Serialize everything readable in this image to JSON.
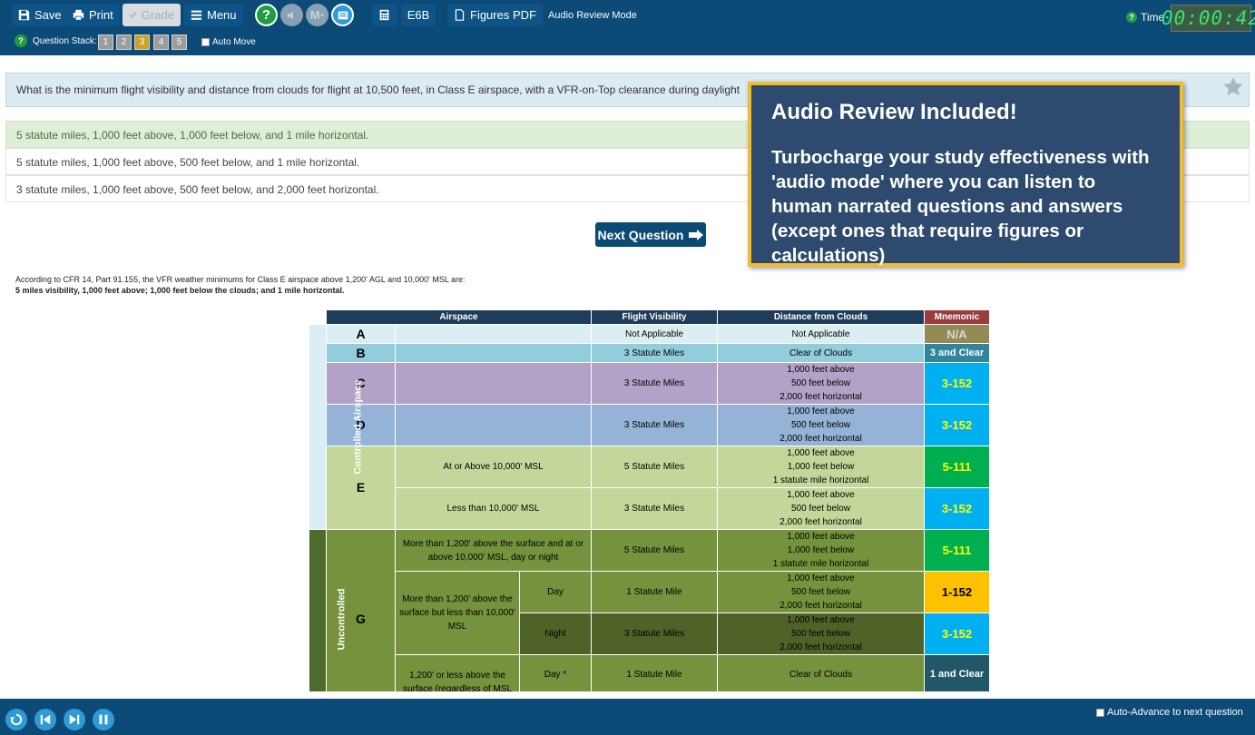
{
  "toolbar": {
    "save_label": "Save",
    "print_label": "Print",
    "grade_label": "Grade",
    "menu_label": "Menu",
    "e6b_label": "E6B",
    "figures_label": "Figures PDF",
    "mode_label": "Audio Review Mode",
    "help_icon": "question-icon",
    "mute_icon": "speaker-mute-icon",
    "memory_label": "M",
    "notes_icon": "notes-icon",
    "calculator_icon": "calculator-icon",
    "question_stack_label": "Question Stack:",
    "question_stack": [
      "1",
      "2",
      "3",
      "4",
      "5"
    ],
    "current_stack_item": "3",
    "auto_move_label": "Auto Move",
    "time_label": "Time",
    "timer": "00:00:42",
    "accent": "#0c4a77"
  },
  "question": {
    "text": "What is the minimum flight visibility and distance from clouds for flight at 10,500 feet, in Class E airspace, with a VFR-on-Top clearance during daylight"
  },
  "answers": [
    {
      "text": "5 statute miles, 1,000 feet above, 1,000 feet below, and 1 mile horizontal.",
      "correct": true
    },
    {
      "text": "5 statute miles, 1,000 feet above, 500 feet below, and 1 mile horizontal.",
      "correct": false
    },
    {
      "text": "3 statute miles, 1,000 feet above, 500 feet below, and 2,000 feet horizontal.",
      "correct": false
    }
  ],
  "next_button_label": "Next Question",
  "callout": {
    "title": "Audio Review Included!",
    "body": "Turbocharge your study effectiveness with 'audio mode' where you can listen to human narrated  questions and answers (except ones that require figures or calculations)"
  },
  "explanation": {
    "line1": "According to CFR 14, Part 91.155, the VFR weather minimums for Class E airspace above 1,200' AGL and 10,000' MSL are:",
    "line2": "5 miles visibility, 1,000 feet above; 1,000 feet below the clouds; and 1 mile horizontal."
  },
  "table": {
    "headers": {
      "airspace": "Airspace",
      "visibility": "Flight Visibility",
      "clouds": "Distance from Clouds",
      "mnemonic": "Mnemonic"
    },
    "side_controlled": "Controlled Airspace",
    "side_uncontrolled": "Uncontrolled",
    "classes": {
      "a": "A",
      "b": "B",
      "c": "C",
      "d": "D",
      "e": "E",
      "g": "G"
    },
    "row_a": {
      "vis": "Not Applicable",
      "clouds": "Not Applicable",
      "mn": "N/A"
    },
    "row_b": {
      "vis": "3 Statute Miles",
      "clouds": "Clear of Clouds",
      "mn": "3 and Clear"
    },
    "row_c": {
      "vis": "3 Statute Miles",
      "c1": "1,000 feet above",
      "c2": "500 feet below",
      "c3": "2,000 feet horizontal",
      "mn": "3-152"
    },
    "row_d": {
      "vis": "3 Statute Miles",
      "c1": "1,000 feet above",
      "c2": "500 feet below",
      "c3": "2,000 feet horizontal",
      "mn": "3-152"
    },
    "row_e1": {
      "desc": "At or Above 10,000' MSL",
      "vis": "5 Statute Miles",
      "c1": "1,000 feet above",
      "c2": "1,000 feet below",
      "c3": "1 statute mile horizontal",
      "mn": "5-111"
    },
    "row_e2": {
      "desc": "Less than 10,000' MSL",
      "vis": "3 Statute Miles",
      "c1": "1,000 feet above",
      "c2": "500 feet below",
      "c3": "2,000 feet horizontal",
      "mn": "3-152"
    },
    "row_g1": {
      "desc": "More than 1,200' above the surface and at or above 10,000' MSL, day or night",
      "vis": "5 Statute Miles",
      "c1": "1,000 feet above",
      "c2": "1,000 feet below",
      "c3": "1 statute mile horizontal",
      "mn": "5-111"
    },
    "row_g2": {
      "desc": "More than 1,200' above the surface but less than 10,000' MSL",
      "sub": "Day",
      "vis": "1 Statute Mile",
      "c1": "1,000 feet above",
      "c2": "500 feet below",
      "c3": "2,000 feet horizontal",
      "mn": "1-152"
    },
    "row_g3": {
      "sub": "Night",
      "vis": "3 Statute Miles",
      "c1": "1,000 feet above",
      "c2": "500 feet below",
      "c3": "2,000 feet horizontal",
      "mn": "3-152"
    },
    "row_g4": {
      "desc": "1,200' or less above the surface (regardless of MSL",
      "sub": "Day *",
      "vis": "1 Statute Mile",
      "clouds": "Clear of Clouds",
      "mn": "1 and Clear"
    }
  },
  "bottom": {
    "restart_icon": "restart-icon",
    "prev_icon": "skip-back-icon",
    "next_icon": "skip-forward-icon",
    "pause_icon": "pause-icon",
    "auto_advance_label": "Auto-Advance to next question"
  }
}
